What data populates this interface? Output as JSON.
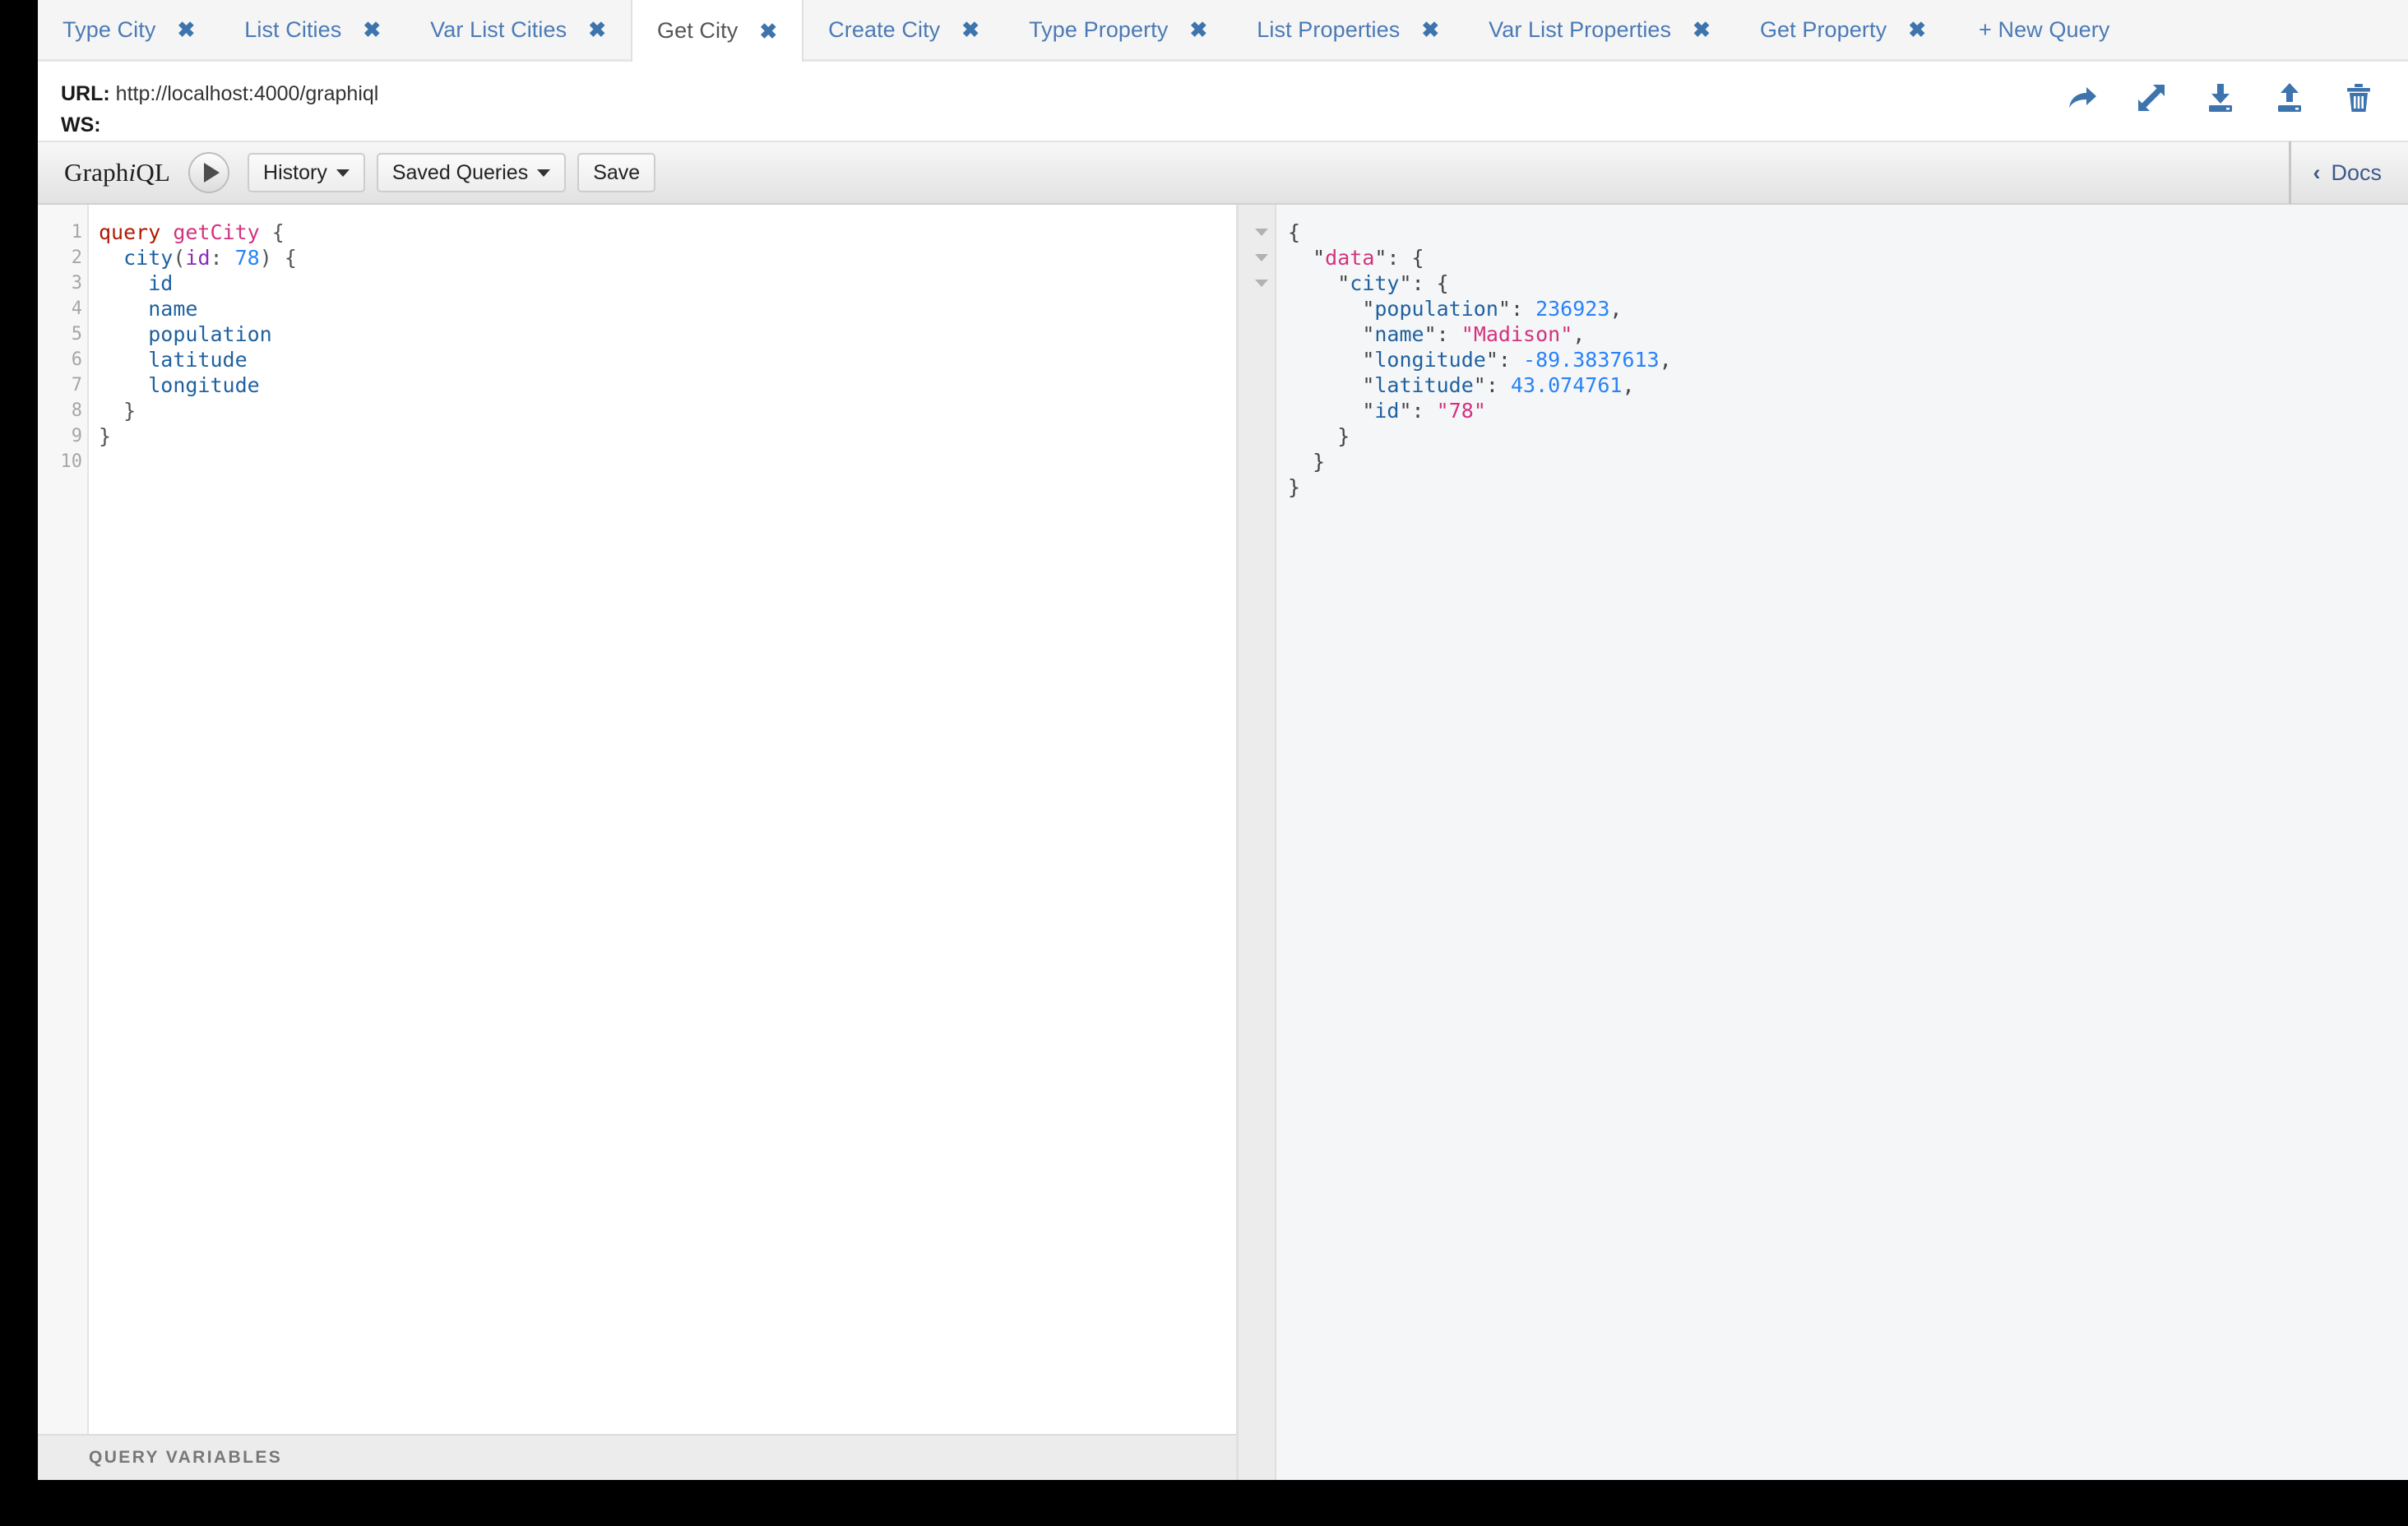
{
  "tabs": {
    "items": [
      {
        "label": "Type City",
        "active": false,
        "closable": true
      },
      {
        "label": "List Cities",
        "active": false,
        "closable": true
      },
      {
        "label": "Var List Cities",
        "active": false,
        "closable": true
      },
      {
        "label": "Get City",
        "active": true,
        "closable": true
      },
      {
        "label": "Create City",
        "active": false,
        "closable": true
      },
      {
        "label": "Type Property",
        "active": false,
        "closable": true
      },
      {
        "label": "List Properties",
        "active": false,
        "closable": true
      },
      {
        "label": "Var List Properties",
        "active": false,
        "closable": true
      },
      {
        "label": "Get Property",
        "active": false,
        "closable": true
      }
    ],
    "close_glyph": "✖",
    "new_query_label": "+ New Query"
  },
  "endpoint": {
    "url_label": "URL:",
    "url_value": "http://localhost:4000/graphiql",
    "ws_label": "WS:",
    "ws_value": ""
  },
  "endpoint_actions": [
    {
      "name": "share-icon"
    },
    {
      "name": "expand-icon"
    },
    {
      "name": "download-icon"
    },
    {
      "name": "upload-icon"
    },
    {
      "name": "trash-icon"
    }
  ],
  "toolbar": {
    "logo_graph": "Graph",
    "logo_i": "i",
    "logo_ql": "QL",
    "execute_label": "▶",
    "history_label": "History",
    "saved_queries_label": "Saved Queries",
    "save_label": "Save",
    "docs_label": "Docs",
    "docs_chevron": "‹"
  },
  "query_editor": {
    "line_numbers": [
      "1",
      "2",
      "3",
      "4",
      "5",
      "6",
      "7",
      "8",
      "9",
      "10"
    ],
    "fold_lines": [
      1,
      2
    ],
    "text": "query getCity {\n  city(id: 78) {\n    id\n    name\n    population\n    latitude\n    longitude\n  }\n}\n",
    "tokens": {
      "keyword": "query",
      "operation_name": "getCity",
      "root_field": "city",
      "argument_name": "id",
      "argument_value": "78",
      "fields": [
        "id",
        "name",
        "population",
        "latitude",
        "longitude"
      ]
    },
    "query_variables_label": "QUERY VARIABLES"
  },
  "result": {
    "fold_lines": [
      1,
      2,
      3
    ],
    "data_key": "data",
    "city_key": "city",
    "fields": [
      {
        "key": "population",
        "value": "236923",
        "type": "number"
      },
      {
        "key": "name",
        "value": "Madison",
        "type": "string"
      },
      {
        "key": "longitude",
        "value": "-89.3837613",
        "type": "number"
      },
      {
        "key": "latitude",
        "value": "43.074761",
        "type": "number"
      },
      {
        "key": "id",
        "value": "78",
        "type": "string"
      }
    ]
  },
  "colors": {
    "tab_link": "#4a7ab5",
    "tab_active_text": "#555555",
    "icon_blue": "#3d74ad",
    "docs_blue": "#3b5a8c",
    "keyword_red": "#b11a04",
    "operation_pink": "#d2337f",
    "field_blue": "#1f61a0",
    "argument_purple": "#8b2bb9",
    "number_blue": "#2882f9",
    "result_bg": "#f5f6f7",
    "toolbar_bg": "#eeeeee"
  }
}
